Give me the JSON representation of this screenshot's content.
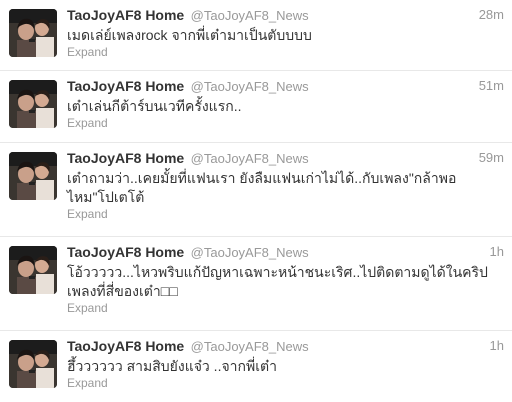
{
  "tweets": [
    {
      "fullname": "TaoJoyAF8 Home",
      "username": "@TaoJoyAF8_News",
      "time": "28m",
      "text": "เมดเล่ย์เพลงrock จากพี่เต๋ามาเป็นตับบบบ",
      "expand": "Expand",
      "avatar_icon": "profile-photo-icon"
    },
    {
      "fullname": "TaoJoyAF8 Home",
      "username": "@TaoJoyAF8_News",
      "time": "51m",
      "text": "เต๋าเล่นกีต้าร์บนเวทีครั้งแรก..",
      "expand": "Expand",
      "avatar_icon": "profile-photo-icon"
    },
    {
      "fullname": "TaoJoyAF8 Home",
      "username": "@TaoJoyAF8_News",
      "time": "59m",
      "text": "เต๋าถามว่า..เคยมั้ยที่แฟนเรา ยังลืมแฟนเก่าไม่ได้..กับเพลง\"กล้าพอไหม\"โปเตโต้",
      "expand": "Expand",
      "avatar_icon": "profile-photo-icon"
    },
    {
      "fullname": "TaoJoyAF8 Home",
      "username": "@TaoJoyAF8_News",
      "time": "1h",
      "text": "โอ้ววววว...ไหวพริบแก้ปัญหาเฉพาะหน้าชนะเริศ..ไปติดตามดูได้ในคริปเพลงที่สี่ของเต๋า□□",
      "expand": "Expand",
      "avatar_icon": "profile-photo-icon"
    },
    {
      "fullname": "TaoJoyAF8 Home",
      "username": "@TaoJoyAF8_News",
      "time": "1h",
      "text": "ฮึ้วววววว สามสิบยังแจ๋ว ..จากพี่เต๋า",
      "expand": "Expand",
      "avatar_icon": "profile-photo-icon"
    }
  ],
  "colors": {
    "name": "#333333",
    "meta": "#999999",
    "divider": "#e8e8e8"
  }
}
